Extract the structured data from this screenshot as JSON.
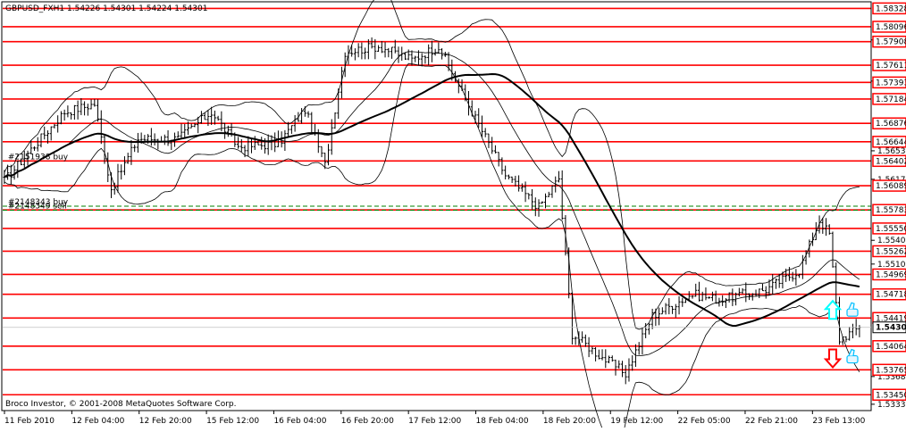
{
  "header": {
    "symbol_line": "GBPUSD_FXH1  1.54226 1.54301 1.54224 1.54301"
  },
  "footer": {
    "copyright": "Broco Investor, © 2001-2008 MetaQuotes Software Corp."
  },
  "colors": {
    "background": "#ffffff",
    "levels": "#ff0000",
    "candles": "#000000",
    "bands": "#000000",
    "moving_average": "#000000",
    "order_dashed": "#008000",
    "axis_box_fill": "#ff0000",
    "arrow_up": "#00ffff",
    "arrow_down": "#ff0000",
    "thumbs": "#00bfff"
  },
  "chart_data": {
    "type": "candlestick",
    "title": "GBPUSD_FXH1  1.54226 1.54301 1.54224 1.54301",
    "symbol": "GBPUSD_FX",
    "timeframe": "H1",
    "last_quote": {
      "open": 1.54226,
      "high": 1.54301,
      "low": 1.54224,
      "close": 1.54301
    },
    "ylim": [
      1.5325,
      1.584
    ],
    "grid": false,
    "x_ticks": [
      "11 Feb 2010",
      "12 Feb 04:00",
      "12 Feb 20:00",
      "15 Feb 12:00",
      "16 Feb 04:00",
      "16 Feb 20:00",
      "17 Feb 12:00",
      "18 Feb 04:00",
      "18 Feb 20:00",
      "19 Feb 12:00",
      "22 Feb 05:00",
      "22 Feb 21:00",
      "23 Feb 13:00"
    ],
    "x_count": 260,
    "last_index": 256,
    "price_ticks": [
      "1.57930",
      "1.57410",
      "1.56530",
      "1.56170",
      "1.55400",
      "1.55100",
      "1.53680",
      "1.53330"
    ],
    "levels": [
      {
        "price": 1.58328,
        "label": "1.58328"
      },
      {
        "price": 1.58096,
        "label": "1.58096"
      },
      {
        "price": 1.57908,
        "label": "1.57908"
      },
      {
        "price": 1.57611,
        "label": "1.57611"
      },
      {
        "price": 1.57393,
        "label": "1.57393"
      },
      {
        "price": 1.57184,
        "label": "1.57184"
      },
      {
        "price": 1.56876,
        "label": "1.56876"
      },
      {
        "price": 1.56644,
        "label": "1.56644"
      },
      {
        "price": 1.56402,
        "label": "1.56402"
      },
      {
        "price": 1.56089,
        "label": "1.56089"
      },
      {
        "price": 1.55783,
        "label": "1.55783"
      },
      {
        "price": 1.5555,
        "label": "1.55550"
      },
      {
        "price": 1.55262,
        "label": "1.55262"
      },
      {
        "price": 1.54969,
        "label": "1.54969"
      },
      {
        "price": 1.54718,
        "label": "1.54718"
      },
      {
        "price": 1.54419,
        "label": "1.54419"
      },
      {
        "price": 1.54064,
        "label": "1.54064"
      },
      {
        "price": 1.53765,
        "label": "1.53765"
      },
      {
        "price": 1.5345,
        "label": "1.53450"
      }
    ],
    "current_price": {
      "price": 1.54301,
      "label": "1.54301"
    },
    "orders": [
      {
        "label": "#2151938 buy",
        "price": 1.56402,
        "x_index": 0,
        "line": false
      },
      {
        "label": "#2148343 buy",
        "price": 1.5583,
        "x_index": 0,
        "line": true
      },
      {
        "label": "#2148349 sell",
        "price": 1.5578,
        "x_index": 0,
        "line": true
      }
    ],
    "signals": [
      {
        "type": "buy",
        "x_index": 248,
        "price": 1.5451
      },
      {
        "type": "sell",
        "x_index": 248,
        "price": 1.5392
      }
    ],
    "key_points": [
      {
        "i": 0,
        "p": 1.5615
      },
      {
        "i": 8,
        "p": 1.5655
      },
      {
        "i": 18,
        "p": 1.5702
      },
      {
        "i": 27,
        "p": 1.5712
      },
      {
        "i": 32,
        "p": 1.5605
      },
      {
        "i": 40,
        "p": 1.5668
      },
      {
        "i": 52,
        "p": 1.5668
      },
      {
        "i": 62,
        "p": 1.5702
      },
      {
        "i": 70,
        "p": 1.5658
      },
      {
        "i": 82,
        "p": 1.5662
      },
      {
        "i": 90,
        "p": 1.5705
      },
      {
        "i": 96,
        "p": 1.5635
      },
      {
        "i": 102,
        "p": 1.5778
      },
      {
        "i": 112,
        "p": 1.5785
      },
      {
        "i": 122,
        "p": 1.5768
      },
      {
        "i": 130,
        "p": 1.5785
      },
      {
        "i": 138,
        "p": 1.5718
      },
      {
        "i": 150,
        "p": 1.5622
      },
      {
        "i": 160,
        "p": 1.5582
      },
      {
        "i": 166,
        "p": 1.5618
      },
      {
        "i": 170,
        "p": 1.5422
      },
      {
        "i": 178,
        "p": 1.5395
      },
      {
        "i": 186,
        "p": 1.5372
      },
      {
        "i": 194,
        "p": 1.5445
      },
      {
        "i": 206,
        "p": 1.5472
      },
      {
        "i": 214,
        "p": 1.5465
      },
      {
        "i": 228,
        "p": 1.5478
      },
      {
        "i": 238,
        "p": 1.5502
      },
      {
        "i": 244,
        "p": 1.5565
      },
      {
        "i": 247,
        "p": 1.5548
      },
      {
        "i": 250,
        "p": 1.5415
      },
      {
        "i": 256,
        "p": 1.543
      }
    ]
  }
}
